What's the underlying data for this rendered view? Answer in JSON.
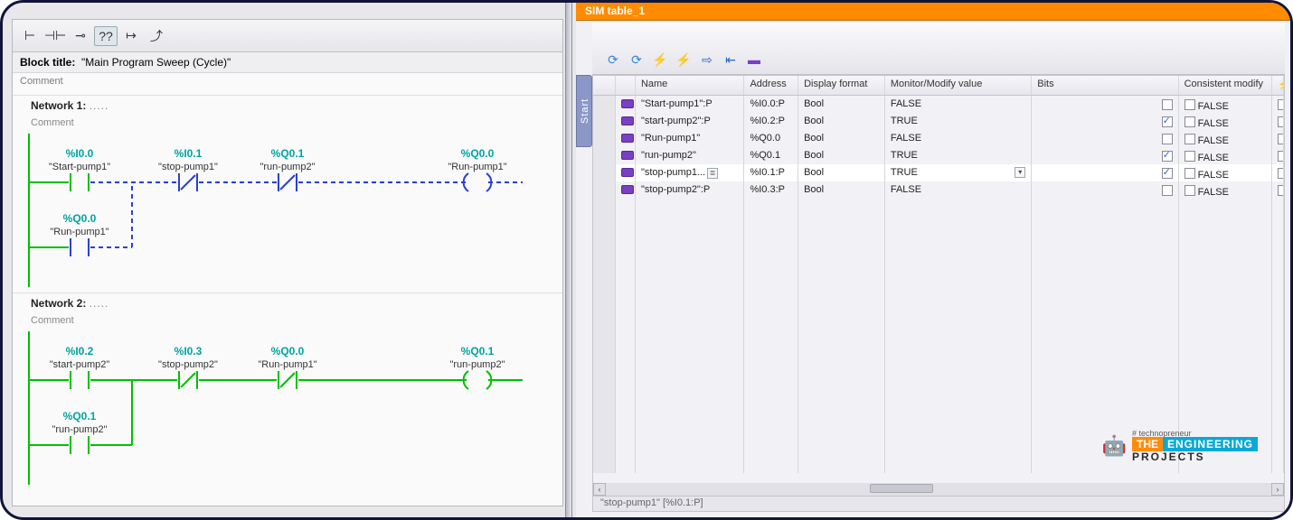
{
  "left_panel": {
    "block_title_label": "Block title:",
    "block_title_value": "\"Main Program Sweep (Cycle)\"",
    "comment_label": "Comment",
    "toolbar_icons": [
      "open-contact",
      "closed-contact",
      "coil-open",
      "question-box",
      "arrow-right",
      "arrow-turn"
    ],
    "networks": [
      {
        "header_label": "Network 1:",
        "dots": ".....",
        "comment": "Comment",
        "rungs": [
          {
            "path": "main",
            "on_until": 1,
            "elements": [
              {
                "addr": "%I0.0",
                "name": "\"Start-pump1\"",
                "type": "NO",
                "state": "closed"
              },
              {
                "addr": "%I0.1",
                "name": "\"stop-pump1\"",
                "type": "NC",
                "state": "open"
              },
              {
                "addr": "%Q0.1",
                "name": "\"run-pump2\"",
                "type": "NC",
                "state": "open"
              },
              {
                "addr": "%Q0.0",
                "name": "\"Run-pump1\"",
                "type": "COIL",
                "state": "off"
              }
            ]
          },
          {
            "path": "branch",
            "elements": [
              {
                "addr": "%Q0.0",
                "name": "\"Run-pump1\"",
                "type": "NO",
                "state": "open"
              }
            ]
          }
        ]
      },
      {
        "header_label": "Network 2:",
        "dots": ".....",
        "comment": "Comment",
        "rungs": [
          {
            "path": "main",
            "on_until": 4,
            "elements": [
              {
                "addr": "%I0.2",
                "name": "\"start-pump2\"",
                "type": "NO",
                "state": "closed"
              },
              {
                "addr": "%I0.3",
                "name": "\"stop-pump2\"",
                "type": "NC",
                "state": "closed"
              },
              {
                "addr": "%Q0.0",
                "name": "\"Run-pump1\"",
                "type": "NC",
                "state": "closed"
              },
              {
                "addr": "%Q0.1",
                "name": "\"run-pump2\"",
                "type": "COIL",
                "state": "on"
              }
            ]
          },
          {
            "path": "branch",
            "elements": [
              {
                "addr": "%Q0.1",
                "name": "\"run-pump2\"",
                "type": "NO",
                "state": "closed"
              }
            ]
          }
        ]
      }
    ]
  },
  "right_panel": {
    "window_title": "SIM table_1",
    "start_tab_label": "Start",
    "toolbar_icons": [
      "refresh",
      "refresh-all",
      "flash",
      "flash-all",
      "export",
      "import",
      "tag"
    ],
    "columns": {
      "idx": "",
      "tag": "",
      "name": "Name",
      "addr": "Address",
      "fmt": "Display format",
      "mon": "Monitor/Modify value",
      "bits": "Bits",
      "cons": "Consistent modify",
      "end": ""
    },
    "rows": [
      {
        "name": "\"Start-pump1\":P",
        "addr": "%I0.0:P",
        "fmt": "Bool",
        "mon": "FALSE",
        "bit_checked": false,
        "cons": "FALSE",
        "sel": false
      },
      {
        "name": "\"start-pump2\":P",
        "addr": "%I0.2:P",
        "fmt": "Bool",
        "mon": "TRUE",
        "bit_checked": true,
        "cons": "FALSE",
        "sel": false
      },
      {
        "name": "\"Run-pump1\"",
        "addr": "%Q0.0",
        "fmt": "Bool",
        "mon": "FALSE",
        "bit_checked": false,
        "cons": "FALSE",
        "sel": false
      },
      {
        "name": "\"run-pump2\"",
        "addr": "%Q0.1",
        "fmt": "Bool",
        "mon": "TRUE",
        "bit_checked": true,
        "cons": "FALSE",
        "sel": false
      },
      {
        "name": "\"stop-pump1...",
        "addr": "%I0.1:P",
        "fmt": "Bool",
        "mon": "TRUE",
        "bit_checked": true,
        "cons": "FALSE",
        "sel": true,
        "name_extra_btn": true,
        "mon_dd": true
      },
      {
        "name": "\"stop-pump2\":P",
        "addr": "%I0.3:P",
        "fmt": "Bool",
        "mon": "FALSE",
        "bit_checked": false,
        "cons": "FALSE",
        "sel": false
      }
    ],
    "footer_text": "\"stop-pump1\" [%I0.1:P]"
  },
  "watermark": {
    "tagline": "# technopreneur",
    "the": "THE",
    "eng": "ENGINEERING",
    "proj": "PROJECTS"
  },
  "flash_icon": "⚡"
}
